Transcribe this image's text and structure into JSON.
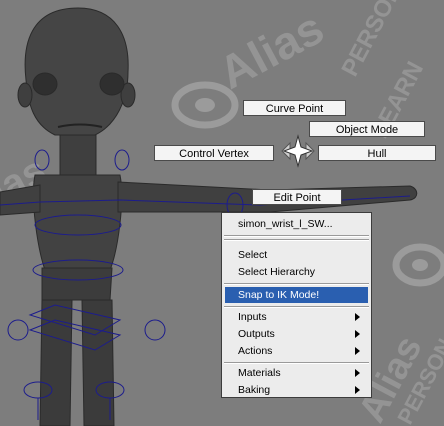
{
  "marking_menu": {
    "north": "Curve Point",
    "northeast": "Object Mode",
    "west": "Control Vertex",
    "east": "Hull",
    "south": "Edit Point"
  },
  "context_menu": {
    "object_name": "simon_wrist_l_SW...",
    "items": [
      {
        "label": "Select",
        "submenu": false
      },
      {
        "label": "Select Hierarchy",
        "submenu": false
      },
      {
        "label": "Snap to IK Mode!",
        "submenu": false,
        "highlighted": true
      },
      {
        "label": "Inputs",
        "submenu": true
      },
      {
        "label": "Outputs",
        "submenu": true
      },
      {
        "label": "Actions",
        "submenu": true
      },
      {
        "label": "Materials",
        "submenu": true
      },
      {
        "label": "Baking",
        "submenu": true
      }
    ]
  },
  "watermark": {
    "brand": "Alias",
    "text_right_1": "PERSON",
    "text_right_2": "LEARN",
    "text_left": "ias",
    "text_bottom": "Alias",
    "text_bottom_right": "PERSON"
  },
  "colors": {
    "viewport_bg": "#7d7d7d",
    "wireframe": "#1c1c8c",
    "highlight": "#2a5fb0",
    "model": "#3a3a3a"
  },
  "icons": {
    "marking_center": "sparkle-star-icon",
    "submenu": "submenu-arrow-icon"
  }
}
